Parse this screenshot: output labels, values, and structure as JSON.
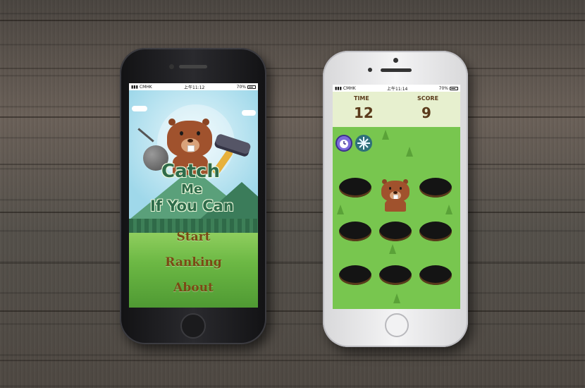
{
  "left_phone": {
    "status": {
      "carrier": "CMHK",
      "time": "上午11:12",
      "battery": "70%"
    },
    "title": {
      "line1": "Catch",
      "line2": "Me",
      "line3": "If You Can"
    },
    "menu": [
      {
        "label": "Start"
      },
      {
        "label": "Ranking"
      },
      {
        "label": "About"
      }
    ]
  },
  "right_phone": {
    "status": {
      "carrier": "CMHK",
      "time": "上午11:14",
      "battery": "70%"
    },
    "hud": {
      "time_label": "TIME",
      "time_value": "12",
      "score_label": "SCORE",
      "score_value": "9"
    },
    "powerups": [
      "alarm-clock-icon",
      "snowflake-icon"
    ],
    "board": {
      "rows": 3,
      "cols": 3,
      "mole_in_hole": [
        0,
        1
      ]
    }
  },
  "colors": {
    "brown_text": "#7a4a14",
    "title_green": "#2e6b4a",
    "grass": "#78c64f",
    "hud_bg": "#e7f0cf"
  }
}
